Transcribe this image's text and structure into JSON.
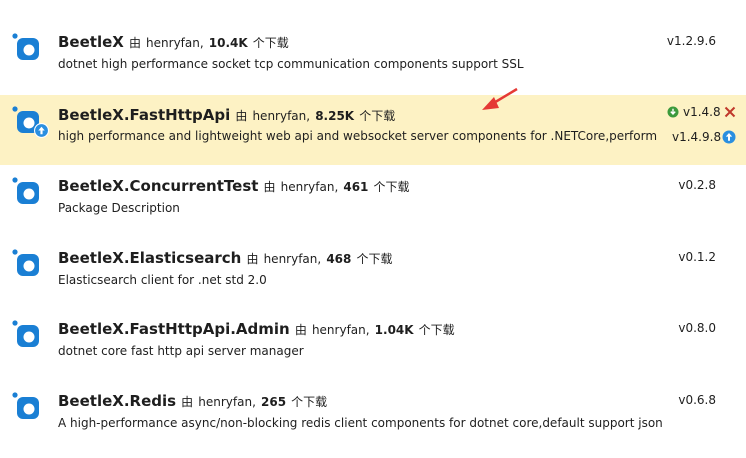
{
  "packages": [
    {
      "title": "BeetleX",
      "by_prefix": "由",
      "author": "henryfan,",
      "downloads": "10.4K",
      "downloads_suffix": "个下载",
      "description": "dotnet high performance socket tcp communication components support SSL",
      "version": "v1.2.9.6"
    },
    {
      "title": "BeetleX.FastHttpApi",
      "by_prefix": "由",
      "author": "henryfan,",
      "downloads": "8.25K",
      "downloads_suffix": "个下载",
      "description": "high performance and lightweight web api and websocket server components for .NETCore,perform...",
      "installed_version": "v1.4.8",
      "latest_version": "v1.4.9.8",
      "selected": true
    },
    {
      "title": "BeetleX.ConcurrentTest",
      "by_prefix": "由",
      "author": "henryfan,",
      "downloads": "461",
      "downloads_suffix": "个下载",
      "description": "Package Description",
      "version": "v0.2.8"
    },
    {
      "title": "BeetleX.Elasticsearch",
      "by_prefix": "由",
      "author": "henryfan,",
      "downloads": "468",
      "downloads_suffix": "个下载",
      "description": "Elasticsearch client for .net std 2.0",
      "version": "v0.1.2"
    },
    {
      "title": "BeetleX.FastHttpApi.Admin",
      "by_prefix": "由",
      "author": "henryfan,",
      "downloads": "1.04K",
      "downloads_suffix": "个下载",
      "description": "dotnet core fast http api server manager",
      "version": "v0.8.0"
    },
    {
      "title": "BeetleX.Redis",
      "by_prefix": "由",
      "author": "henryfan,",
      "downloads": "265",
      "downloads_suffix": "个下载",
      "description": "A high-performance async/non-blocking  redis client components for dotnet core,default support json...",
      "version": "v0.6.8"
    }
  ],
  "icons": {
    "package": "nuget-package-icon",
    "update_badge": "update-badge-icon",
    "installed": "installed-check-icon",
    "uninstall": "uninstall-x-icon",
    "update": "update-arrow-icon"
  },
  "colors": {
    "selected_background": "#fdf2c4",
    "package_icon": "#1a7fd4",
    "installed_green": "#3c9a3c",
    "uninstall_red": "#c0392b",
    "update_blue": "#2a8fe0",
    "annotation_arrow": "#e53935"
  }
}
